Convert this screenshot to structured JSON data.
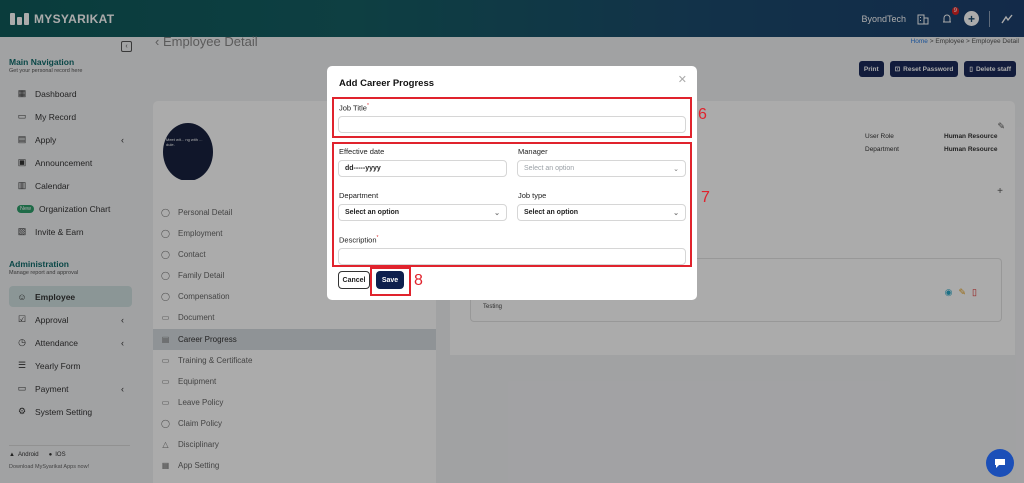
{
  "app": {
    "logo_text": "MYSYARIKAT",
    "company": "ByondTech",
    "notif_count": "9"
  },
  "sidebar": {
    "main_nav_title": "Main Navigation",
    "main_nav_sub": "Get your personal record here",
    "main_items": [
      {
        "label": "Dashboard"
      },
      {
        "label": "My Record"
      },
      {
        "label": "Apply"
      },
      {
        "label": "Announcement"
      },
      {
        "label": "Calendar"
      },
      {
        "label": "Organization Chart",
        "badge": "New"
      },
      {
        "label": "Invite & Earn"
      }
    ],
    "admin_title": "Administration",
    "admin_sub": "Manage report and approval",
    "admin_items": [
      {
        "label": "Employee"
      },
      {
        "label": "Approval"
      },
      {
        "label": "Attendance"
      },
      {
        "label": "Yearly Form"
      },
      {
        "label": "Payment"
      },
      {
        "label": "System Setting"
      }
    ],
    "android": "Android",
    "ios": "IOS",
    "download": "Download MySyarikat Apps now!"
  },
  "main": {
    "page_title": "Employee Detail",
    "breadcrumb": {
      "home": "Home",
      "employee": "Employee",
      "current": "Employee Detail"
    },
    "buttons": {
      "print": "Print",
      "reset_password": "Reset Password",
      "delete_staff": "Delete staff"
    },
    "profile": {
      "avatar_text": "Meet wit... ng with ... dule.",
      "user_role_label": "User Role",
      "user_role_value": "Human Resource",
      "department_label": "Department",
      "department_value": "Human Resource"
    },
    "tabs": [
      {
        "label": "Personal Detail"
      },
      {
        "label": "Employment"
      },
      {
        "label": "Contact"
      },
      {
        "label": "Family Detail"
      },
      {
        "label": "Compensation"
      },
      {
        "label": "Document"
      },
      {
        "label": "Career Progress"
      },
      {
        "label": "Training & Certificate"
      },
      {
        "label": "Equipment"
      },
      {
        "label": "Leave Policy"
      },
      {
        "label": "Claim Policy"
      },
      {
        "label": "Disciplinary"
      },
      {
        "label": "App Setting"
      }
    ],
    "record_text": "Testing"
  },
  "modal": {
    "title": "Add Career Progress",
    "job_title_label": "Job Title",
    "job_title_value": "",
    "effective_date_label": "Effective date",
    "effective_date_value": "dd-----yyyy",
    "manager_label": "Manager",
    "manager_placeholder": "Select an option",
    "department_label": "Department",
    "department_value": "Select an option",
    "job_type_label": "Job type",
    "job_type_value": "Select an option",
    "description_label": "Description",
    "description_value": "",
    "cancel": "Cancel",
    "save": "Save"
  },
  "annotations": {
    "a6": "6",
    "a7": "7",
    "a8": "8"
  },
  "colors": {
    "accent_dark": "#0e1f4d",
    "teal": "#0f6b6b",
    "annotation_red": "#e0232d"
  }
}
